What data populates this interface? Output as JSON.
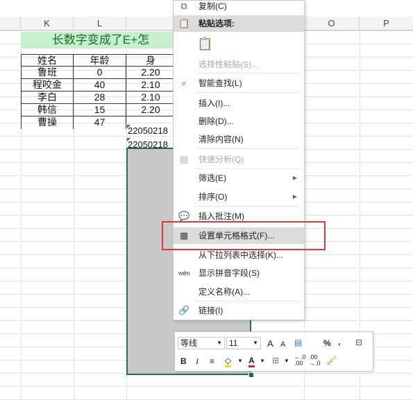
{
  "columns": [
    "K",
    "L",
    "",
    "O",
    "P"
  ],
  "title_text": "长数字变成了E+怎",
  "table": {
    "headers": [
      "姓名",
      "年龄",
      "身"
    ],
    "rows": [
      {
        "name": "鲁班",
        "age": "0",
        "id": "2.20"
      },
      {
        "name": "程咬金",
        "age": "40",
        "id": "2.10"
      },
      {
        "name": "李白",
        "age": "28",
        "id": "2.10"
      },
      {
        "name": "韩信",
        "age": "15",
        "id": "2.20"
      },
      {
        "name": "曹操",
        "age": "47",
        "id": "22050218"
      }
    ],
    "extra_cell": "22050218"
  },
  "context_menu": {
    "copy": "复制(C)",
    "paste_options": "粘贴选项:",
    "paste_special": "选择性粘贴(S)...",
    "smart_lookup": "智能查找(L)",
    "insert": "插入(I)...",
    "delete": "删除(D)...",
    "clear": "清除内容(N)",
    "quick_analysis": "快速分析(Q)",
    "filter": "筛选(E)",
    "sort": "排序(O)",
    "insert_comment": "插入批注(M)",
    "format_cells": "设置单元格格式(F)...",
    "pick_from_list": "从下拉列表中选择(K)...",
    "show_phonetic": "显示拼音字段(S)",
    "define_name": "定义名称(A)...",
    "link": "链接(I)"
  },
  "mini_toolbar": {
    "font_name": "等线",
    "font_size": "11",
    "grow_font": "A",
    "shrink_font": "A",
    "percent": "%",
    "comma": ",",
    "bold": "B",
    "italic": "I",
    "font_color_a": "A",
    "dec_inc": "←.0\n.00",
    "dec_dec": ".00\n→.0"
  },
  "colors": {
    "title_band_bg": "#c6efce",
    "title_text": "#1b6b2a",
    "selection_border": "#217346",
    "highlight_box": "#e0373d"
  }
}
